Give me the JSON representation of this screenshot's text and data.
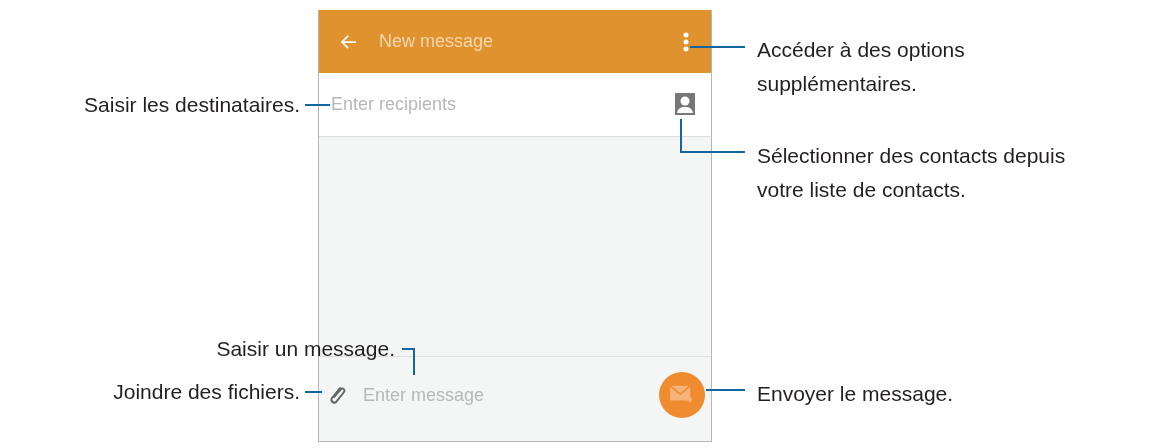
{
  "header": {
    "title": "New message"
  },
  "recipients": {
    "placeholder": "Enter recipients"
  },
  "composer": {
    "placeholder": "Enter message"
  },
  "callouts": [
    {
      "text": "Accéder à des options supplémentaires."
    },
    {
      "text": "Saisir les destinataires."
    },
    {
      "text": "Sélectionner des contacts depuis votre liste de contacts."
    },
    {
      "text": "Saisir un message."
    },
    {
      "text": "Joindre des fichiers."
    },
    {
      "text": "Envoyer le message."
    }
  ]
}
